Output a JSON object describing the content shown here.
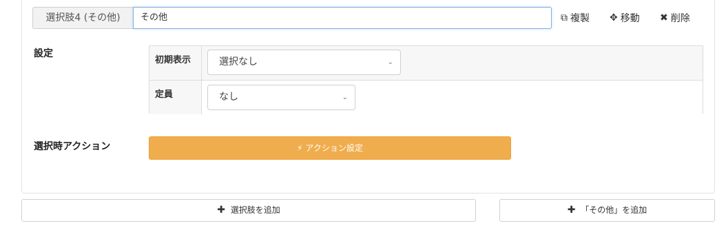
{
  "choice": {
    "label": "選択肢4 (その他)",
    "value": "その他"
  },
  "actions": {
    "duplicate": {
      "icon": "copy-icon",
      "glyph": "⧉",
      "label": "複製"
    },
    "move": {
      "icon": "move-icon",
      "glyph": "✥",
      "label": "移動"
    },
    "delete": {
      "icon": "close-icon",
      "glyph": "✖",
      "label": "削除"
    }
  },
  "settings": {
    "label": "設定",
    "initial_display": {
      "header": "初期表示",
      "selected": "選択なし"
    },
    "capacity": {
      "header": "定員",
      "selected": "なし"
    }
  },
  "selection_action": {
    "label": "選択時アクション",
    "button_icon": "bolt-icon",
    "button_glyph": "⚡",
    "button_label": "アクション設定"
  },
  "footer": {
    "add_choice": {
      "icon": "plus-icon",
      "glyph": "✚",
      "label": "選択肢を追加"
    },
    "add_other": {
      "icon": "plus-icon",
      "glyph": "✚",
      "label": "「その他」を追加"
    }
  },
  "colors": {
    "accent_orange": "#f0ad4e",
    "focus_border": "#7eaee3"
  }
}
